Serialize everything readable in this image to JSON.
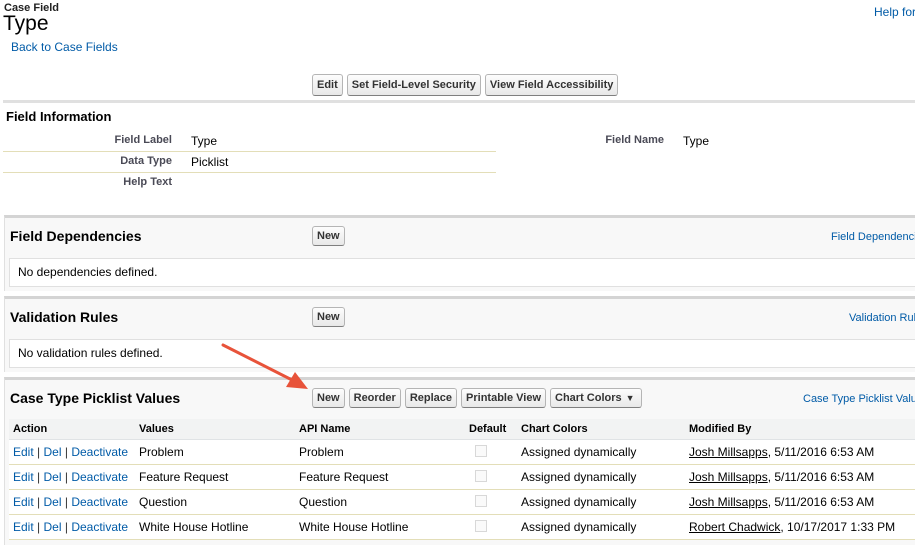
{
  "header": {
    "object_type": "Case Field",
    "title": "Type",
    "back_link": "Back to Case Fields",
    "help_link": "Help for"
  },
  "toolbar": {
    "edit": "Edit",
    "set_fls": "Set Field-Level Security",
    "view_accessibility": "View Field Accessibility"
  },
  "field_info": {
    "title": "Field Information",
    "field_label_label": "Field Label",
    "field_label_value": "Type",
    "field_name_label": "Field Name",
    "field_name_value": "Type",
    "data_type_label": "Data Type",
    "data_type_value": "Picklist",
    "help_text_label": "Help Text",
    "help_text_value": ""
  },
  "dependencies": {
    "title": "Field Dependencies",
    "new_button": "New",
    "help_link": "Field Dependenci",
    "empty": "No dependencies defined."
  },
  "validation": {
    "title": "Validation Rules",
    "new_button": "New",
    "help_link": "Validation Rul",
    "empty": "No validation rules defined."
  },
  "picklist": {
    "title": "Case Type Picklist Values",
    "buttons": {
      "new": "New",
      "reorder": "Reorder",
      "replace": "Replace",
      "printable": "Printable View",
      "chart_colors": "Chart Colors"
    },
    "help_link": "Case Type Picklist Valu",
    "columns": {
      "action": "Action",
      "values": "Values",
      "api_name": "API Name",
      "default": "Default",
      "chart_colors": "Chart Colors",
      "modified_by": "Modified By"
    },
    "action_labels": {
      "edit": "Edit",
      "del": "Del",
      "deactivate": "Deactivate",
      "sep": "|"
    },
    "rows": [
      {
        "value": "Problem",
        "api_name": "Problem",
        "chart_colors": "Assigned dynamically",
        "modified_user": "Josh Millsapps",
        "modified_date": ", 5/11/2016 6:53 AM"
      },
      {
        "value": "Feature Request",
        "api_name": "Feature Request",
        "chart_colors": "Assigned dynamically",
        "modified_user": "Josh Millsapps",
        "modified_date": ", 5/11/2016 6:53 AM"
      },
      {
        "value": "Question",
        "api_name": "Question",
        "chart_colors": "Assigned dynamically",
        "modified_user": "Josh Millsapps",
        "modified_date": ", 5/11/2016 6:53 AM"
      },
      {
        "value": "White House Hotline",
        "api_name": "White House Hotline",
        "chart_colors": "Assigned dynamically",
        "modified_user": "Robert Chadwick",
        "modified_date": ", 10/17/2017 1:33 PM"
      }
    ]
  },
  "colors": {
    "link": "#015ba7",
    "annotation_arrow": "#e8533a"
  }
}
